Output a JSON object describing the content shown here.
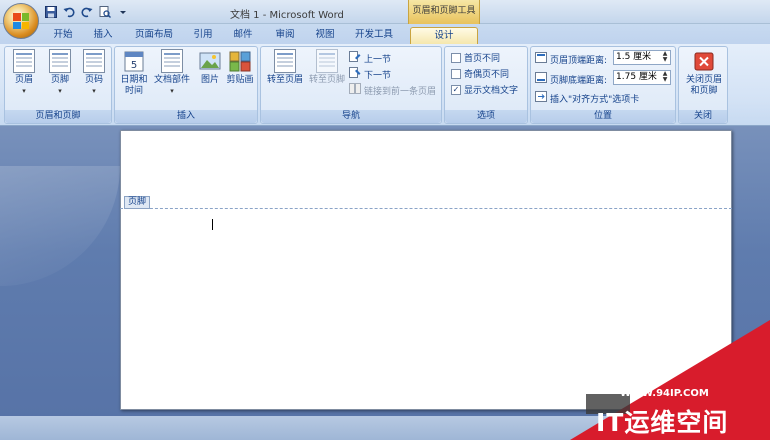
{
  "window": {
    "title": "文档 1 - Microsoft Word",
    "contextual_tab_group": "页眉和页脚工具"
  },
  "qat": {
    "icons": [
      "save-icon",
      "undo-icon",
      "redo-icon",
      "print-preview-icon",
      "customize-icon"
    ]
  },
  "tabs": [
    {
      "label": "开始"
    },
    {
      "label": "插入"
    },
    {
      "label": "页面布局"
    },
    {
      "label": "引用"
    },
    {
      "label": "邮件"
    },
    {
      "label": "审阅"
    },
    {
      "label": "视图"
    },
    {
      "label": "开发工具"
    },
    {
      "label": "设计"
    }
  ],
  "active_tab": "设计",
  "ribbon": {
    "header_footer": {
      "label": "页眉和页脚",
      "header": "页眉",
      "footer": "页脚",
      "page_number": "页码"
    },
    "insert": {
      "label": "插入",
      "datetime_line1": "日期和",
      "datetime_line2": "时间",
      "quickparts": "文档部件",
      "picture": "图片",
      "clipart": "剪贴画"
    },
    "navigation": {
      "label": "导航",
      "goto_header": "转至页眉",
      "goto_footer": "转至页脚",
      "previous": "上一节",
      "next": "下一节",
      "link_previous": "链接到前一条页眉"
    },
    "options": {
      "label": "选项",
      "different_first": "首页不同",
      "different_odd_even": "奇偶页不同",
      "show_doc_text": "显示文档文字",
      "different_first_checked": false,
      "different_odd_even_checked": false,
      "show_doc_text_checked": true
    },
    "position": {
      "label": "位置",
      "header_from_top": "页眉顶端距离:",
      "header_value": "1.5 厘米",
      "footer_from_bottom": "页脚底端距离:",
      "footer_value": "1.75 厘米",
      "insert_alignment_tab": "插入\"对齐方式\"选项卡"
    },
    "close": {
      "label": "关闭",
      "close_line1": "关闭页眉",
      "close_line2": "和页脚"
    }
  },
  "document": {
    "footer_tag": "页脚"
  },
  "watermark": {
    "url": "WWW.94IP.COM",
    "text": "IT运维空间"
  }
}
